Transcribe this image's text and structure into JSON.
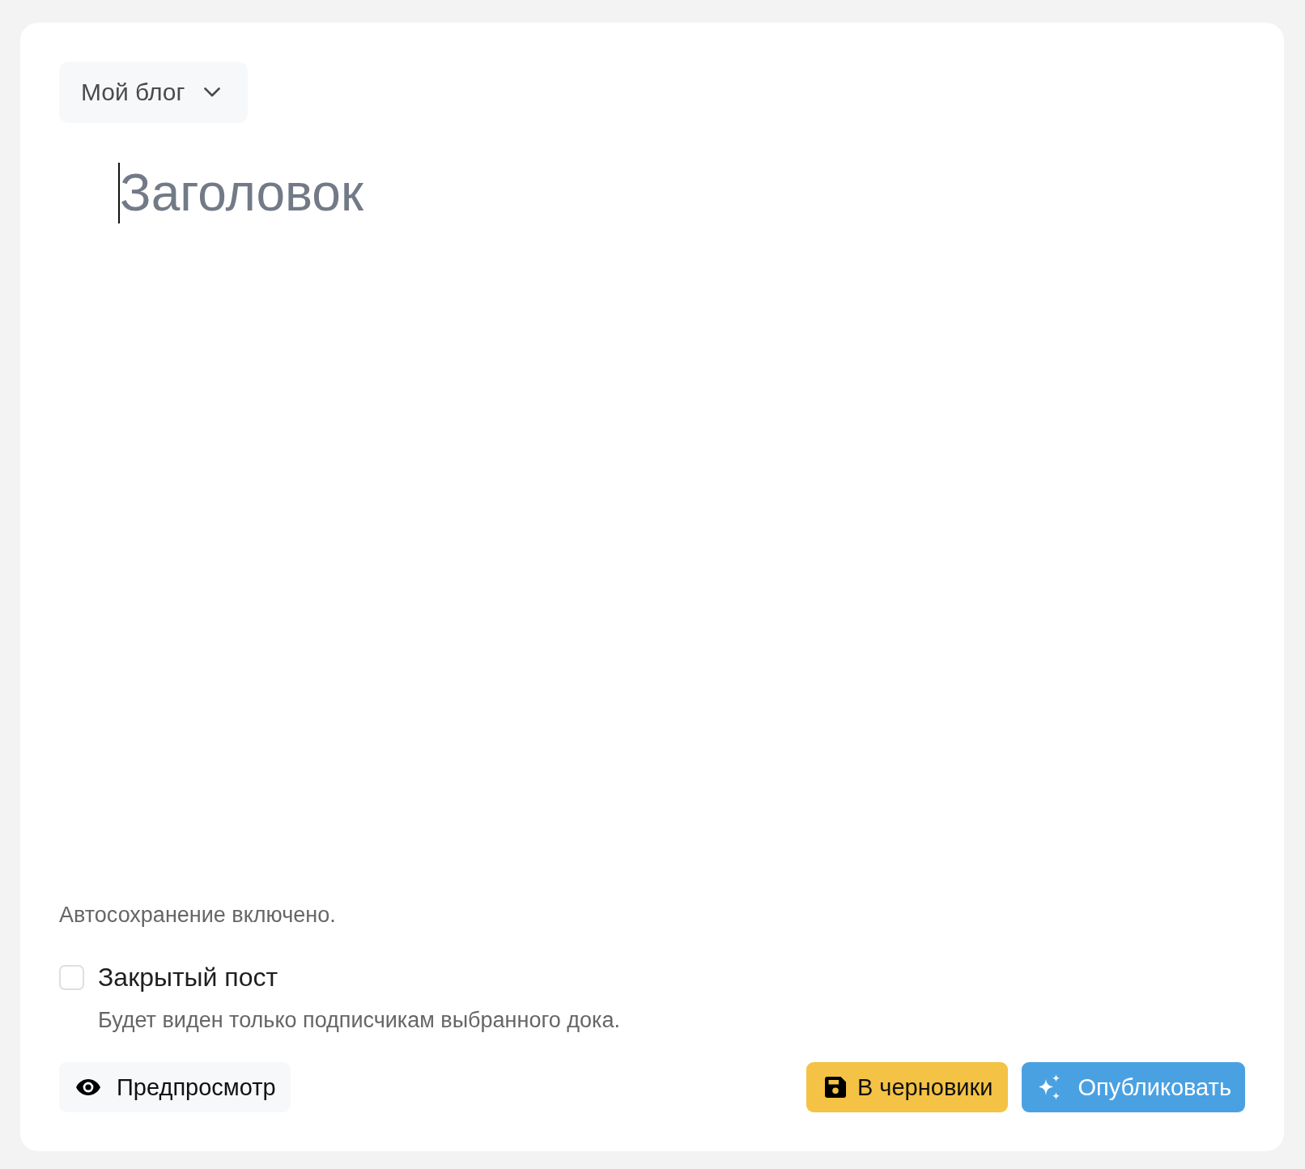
{
  "blog_selector": {
    "label": "Мой блог"
  },
  "title_field": {
    "placeholder": "Заголовок",
    "focused": true
  },
  "autosave_note": "Автосохранение включено.",
  "private_post": {
    "label": "Закрытый пост",
    "checked": false,
    "hint": "Будет виден только подписчикам выбранного дока."
  },
  "buttons": [
    {
      "kind": "preview",
      "label": "Предпросмотр"
    },
    {
      "kind": "draft",
      "label": "В черновики"
    },
    {
      "kind": "publish",
      "label": "Опубликовать"
    }
  ]
}
